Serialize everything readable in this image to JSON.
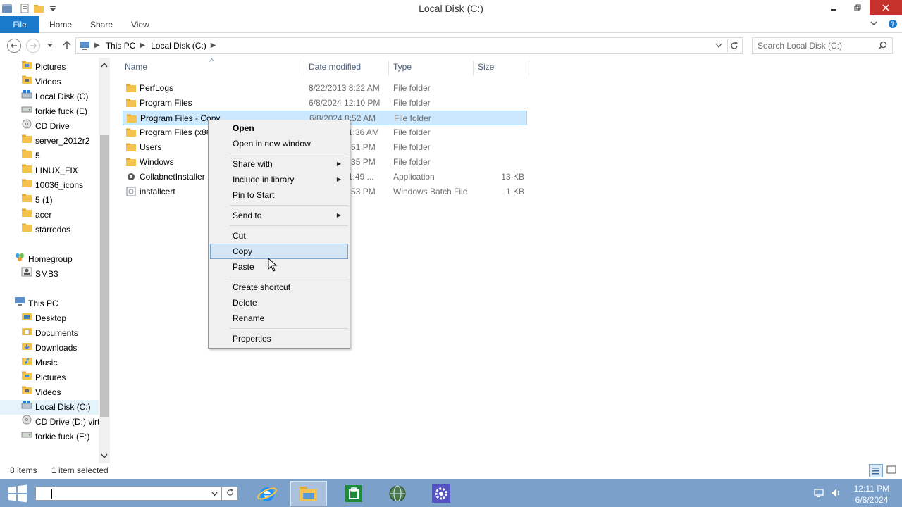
{
  "window": {
    "title": "Local Disk (C:)"
  },
  "ribbon": {
    "tabs": [
      "File",
      "Home",
      "Share",
      "View"
    ]
  },
  "address": {
    "crumbs": [
      "This PC",
      "Local Disk (C:)"
    ],
    "search_placeholder": "Search Local Disk (C:)"
  },
  "nav": {
    "items": [
      {
        "label": "Pictures",
        "icon": "pictures-folder-icon"
      },
      {
        "label": "Videos",
        "icon": "videos-folder-icon"
      },
      {
        "label": "Local Disk (C)",
        "icon": "local-disk-icon"
      },
      {
        "label": "forkie fuck (E)",
        "icon": "drive-icon"
      },
      {
        "label": "CD Drive",
        "icon": "cd-drive-icon"
      },
      {
        "label": "server_2012r2",
        "icon": "folder-icon"
      },
      {
        "label": "5",
        "icon": "folder-icon"
      },
      {
        "label": "LINUX_FIX",
        "icon": "folder-icon"
      },
      {
        "label": "10036_icons",
        "icon": "folder-icon"
      },
      {
        "label": "5 (1)",
        "icon": "folder-icon"
      },
      {
        "label": "acer",
        "icon": "folder-icon"
      },
      {
        "label": "starredos",
        "icon": "folder-icon"
      }
    ],
    "homegroup": {
      "label": "Homegroup",
      "children": [
        "SMB3"
      ]
    },
    "thispc": {
      "label": "This PC",
      "children": [
        "Desktop",
        "Documents",
        "Downloads",
        "Music",
        "Pictures",
        "Videos",
        "Local Disk (C:)",
        "CD Drive (D:) virt",
        "forkie fuck (E:)"
      ]
    }
  },
  "columns": [
    "Name",
    "Date modified",
    "Type",
    "Size"
  ],
  "files": [
    {
      "name": "PerfLogs",
      "date": "8/22/2013 8:22 AM",
      "type": "File folder",
      "size": "",
      "icon": "folder-icon"
    },
    {
      "name": "Program Files",
      "date": "6/8/2024 12:10 PM",
      "type": "File folder",
      "size": "",
      "icon": "folder-icon"
    },
    {
      "name": "Program Files - Copy",
      "date": "6/8/2024 8:52 AM",
      "type": "File folder",
      "size": "",
      "icon": "folder-icon",
      "selected": true
    },
    {
      "name": "Program Files (x86)",
      "date": "6/8/2024 11:36 AM",
      "type": "File folder",
      "size": "",
      "icon": "folder-icon"
    },
    {
      "name": "Users",
      "date": "6/8/2024 8:51 PM",
      "type": "File folder",
      "size": "",
      "icon": "folder-icon"
    },
    {
      "name": "Windows",
      "date": "6/8/2024 8:35 PM",
      "type": "File folder",
      "size": "",
      "icon": "folder-icon"
    },
    {
      "name": "CollabnetInstaller",
      "date": "6/8/2024 11:49 ...",
      "type": "Application",
      "size": "13 KB",
      "icon": "installer-icon"
    },
    {
      "name": "installcert",
      "date": "6/8/2024 8:53 PM",
      "type": "Windows Batch File",
      "size": "1 KB",
      "icon": "batch-file-icon"
    }
  ],
  "context_menu": {
    "groups": [
      [
        {
          "label": "Open",
          "bold": true
        },
        {
          "label": "Open in new window"
        }
      ],
      [
        {
          "label": "Share with",
          "submenu": true
        },
        {
          "label": "Include in library",
          "submenu": true
        },
        {
          "label": "Pin to Start"
        }
      ],
      [
        {
          "label": "Send to",
          "submenu": true
        }
      ],
      [
        {
          "label": "Cut"
        },
        {
          "label": "Copy",
          "hover": true
        },
        {
          "label": "Paste"
        }
      ],
      [
        {
          "label": "Create shortcut"
        },
        {
          "label": "Delete"
        },
        {
          "label": "Rename"
        }
      ],
      [
        {
          "label": "Properties"
        }
      ]
    ]
  },
  "status": {
    "count": "8 items",
    "selected": "1 item selected"
  },
  "taskbar": {
    "apps": [
      "internet-explorer-icon",
      "file-explorer-icon",
      "store-icon",
      "network-globe-icon",
      "settings-gear-icon"
    ],
    "time": "12:11 PM",
    "date": "6/8/2024"
  }
}
